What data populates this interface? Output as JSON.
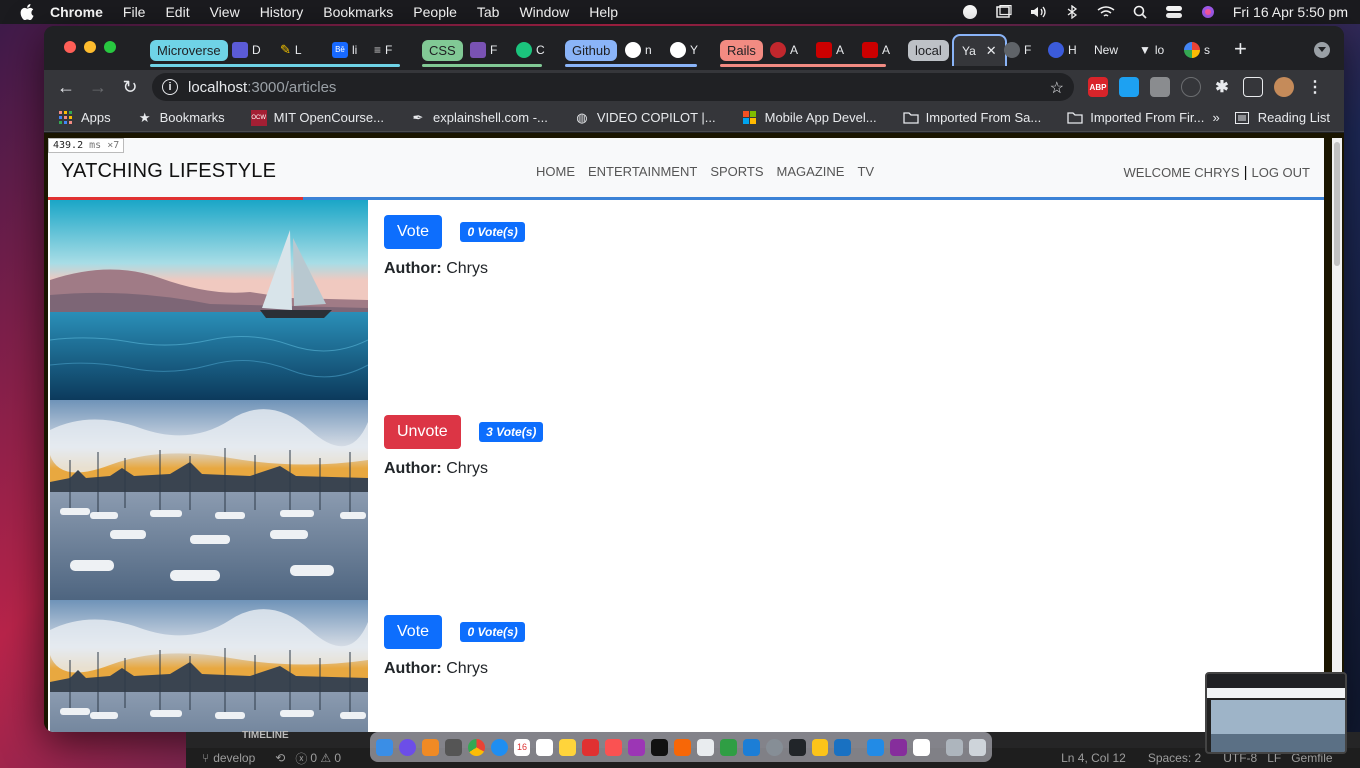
{
  "menubar": {
    "app": "Chrome",
    "items": [
      "File",
      "Edit",
      "View",
      "History",
      "Bookmarks",
      "People",
      "Tab",
      "Window",
      "Help"
    ],
    "clock": "Fri 16 Apr  5:50 pm"
  },
  "tabs": {
    "group_microverse": "Microverse",
    "group_css": "CSS",
    "group_github": "Github",
    "group_rails": "Rails",
    "group_local": "local",
    "short": [
      "D",
      "L",
      "li",
      "F",
      "F",
      "C",
      "n",
      "Y",
      "A",
      "A",
      "A",
      "F",
      "H",
      "lo",
      "s"
    ],
    "active_title": "Ya",
    "new_tab_title": "New",
    "colors": {
      "microverse": "#6fd3e6",
      "css": "#81c995",
      "github": "#8ab4f8",
      "rails": "#f28b82",
      "local": "#bdc1c6"
    }
  },
  "omnibox": {
    "host": "localhost",
    "path": ":3000/articles"
  },
  "extensions": [
    "ABP"
  ],
  "bookmarks": {
    "items": [
      "Apps",
      "Bookmarks",
      "MIT OpenCourse...",
      "explainshell.com -...",
      "VIDEO COPILOT |...",
      "Mobile App Devel...",
      "Imported From Sa...",
      "Imported From Fir..."
    ],
    "reading_list": "Reading List"
  },
  "perf": {
    "value": "439.2",
    "unit": "ms ×7"
  },
  "site": {
    "brand": "YATCHING LIFESTYLE",
    "nav": [
      "HOME",
      "ENTERTAINMENT",
      "SPORTS",
      "MAGAZINE",
      "TV"
    ],
    "welcome": "WELCOME CHRYS",
    "separator": "|",
    "logout": "LOG OUT"
  },
  "articles": [
    {
      "button": "Vote",
      "button_style": "vote",
      "votes": "0 Vote(s)",
      "author_label": "Author:",
      "author": "Chrys",
      "image": "sailboat"
    },
    {
      "button": "Unvote",
      "button_style": "unvote",
      "votes": "3 Vote(s)",
      "author_label": "Author:",
      "author": "Chrys",
      "image": "marina"
    },
    {
      "button": "Vote",
      "button_style": "vote",
      "votes": "0 Vote(s)",
      "author_label": "Author:",
      "author": "Chrys",
      "image": "marina"
    }
  ],
  "ide": {
    "panel": "TIMELINE",
    "branch": "develop",
    "problems": "0 ⚠ 0",
    "cursor": "Ln 4, Col 12",
    "spaces": "Spaces: 2",
    "encoding": "UTF-8",
    "eol": "LF",
    "file_type": "Gemfile"
  },
  "dock_date": "16"
}
